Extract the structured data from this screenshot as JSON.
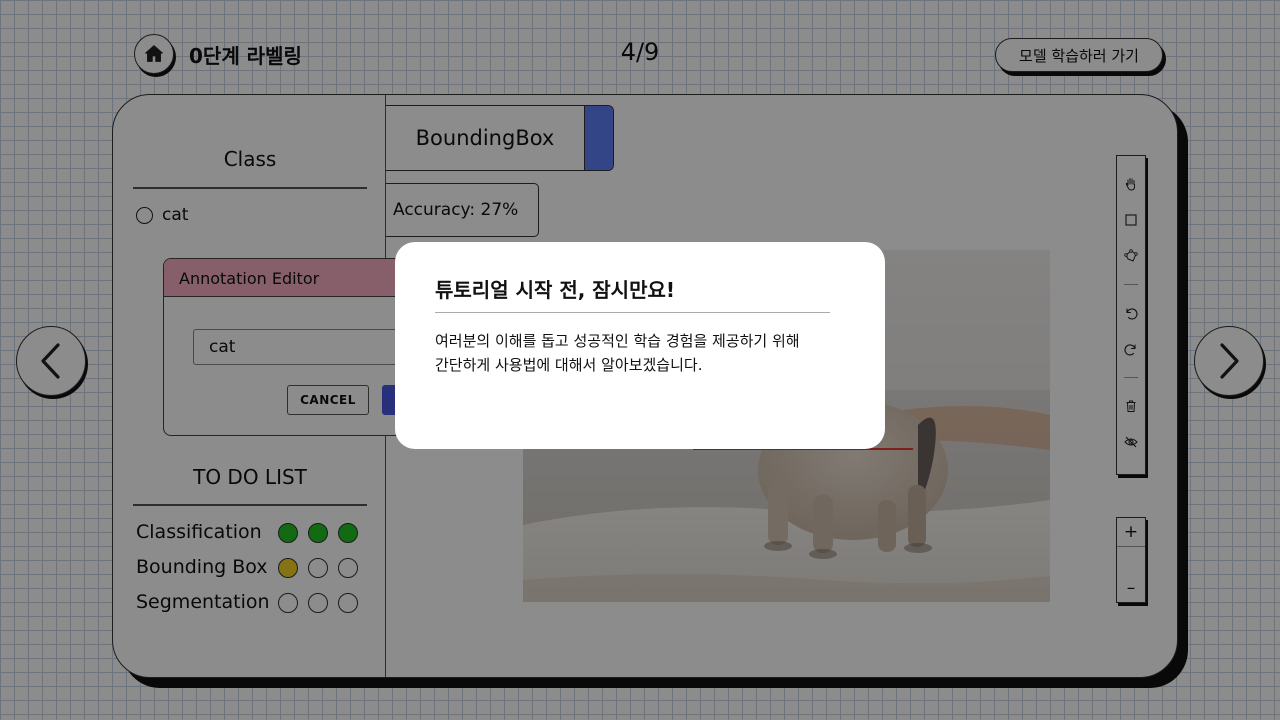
{
  "header": {
    "home_icon": "home-icon",
    "step_title": "0단계 라벨링",
    "page_counter": "4/9",
    "train_button": "모델 학습하러 가기"
  },
  "left_panel": {
    "class_title": "Class",
    "classes": [
      {
        "label": "cat",
        "selected": false
      }
    ],
    "annotation_editor": {
      "title": "Annotation Editor",
      "input_value": "cat",
      "cancel_label": "CANCEL"
    },
    "todo": {
      "title": "TO DO LIST",
      "items": [
        {
          "label": "Classification",
          "done": 3,
          "total": 3
        },
        {
          "label": "Bounding Box",
          "done": 1,
          "total": 3
        },
        {
          "label": "Segmentation",
          "done": 0,
          "total": 3
        }
      ]
    }
  },
  "workspace": {
    "tab_label": "BoundingBox",
    "accuracy": "Accuracy: 27%",
    "tools": [
      "hand-icon",
      "rectangle-icon",
      "polygon-icon",
      "undo-icon",
      "redo-icon",
      "trash-icon",
      "eye-off-icon"
    ],
    "zoom_in_label": "+",
    "zoom_out_label": "–"
  },
  "navigation": {
    "prev_icon": "chevron-left-icon",
    "next_icon": "chevron-right-icon"
  },
  "modal": {
    "title": "튜토리얼 시작 전, 잠시만요!",
    "body_line1": "여러분의 이해를 돕고 성공적인 학습 경험을 제공하기 위해",
    "body_line2": "간단하게 사용법에 대해서 알아보겠습니다."
  },
  "colors": {
    "done_dot": "#22c322",
    "partial_dot": "#f3d226",
    "tab_accent": "#5e7ef6",
    "editor_header": "#f5aec2",
    "confirm_button": "#4a56e0"
  }
}
